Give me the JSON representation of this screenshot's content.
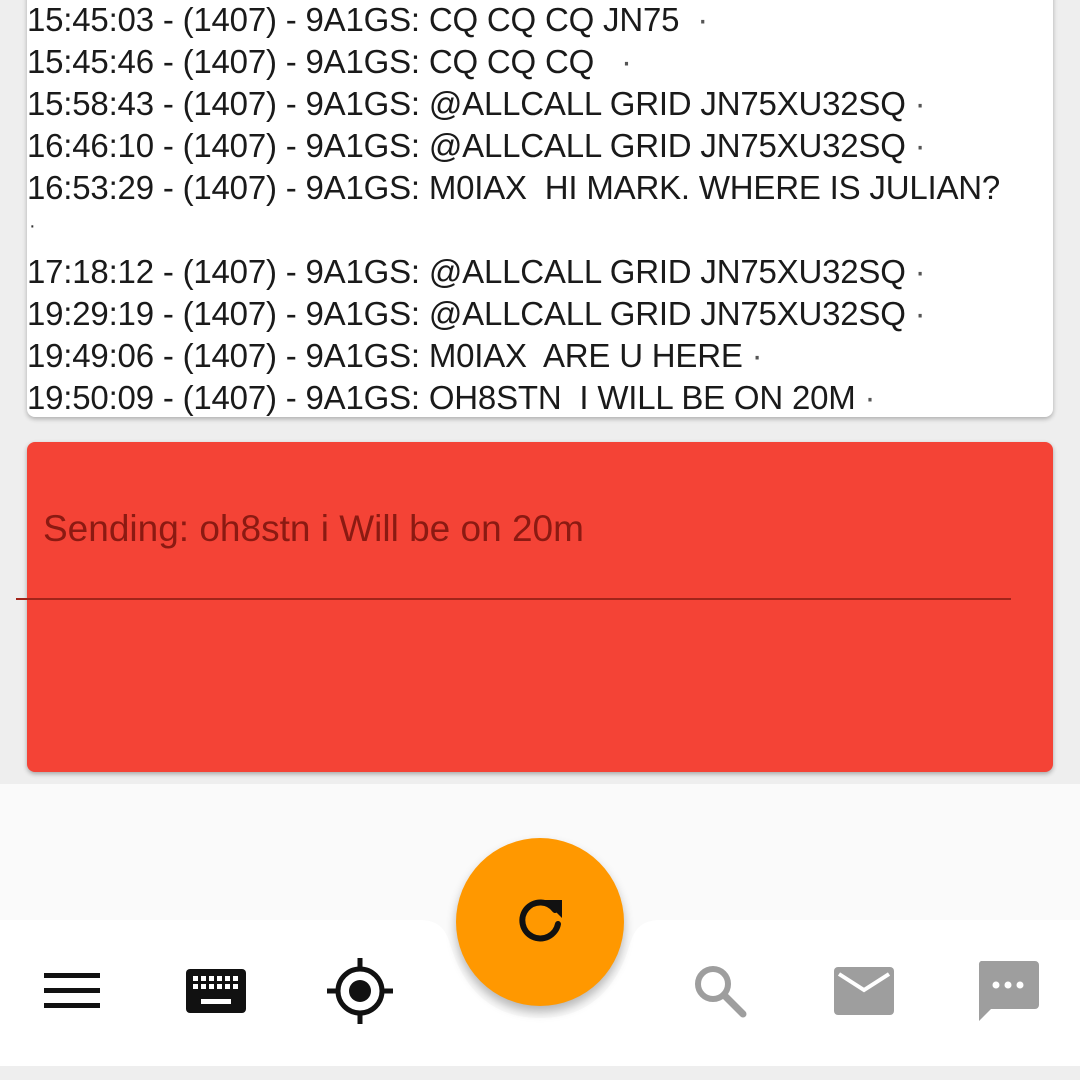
{
  "log": {
    "lines": [
      {
        "text": "15:45:03 - (1407) - 9A1GS: CQ CQ CQ JN75  ",
        "dot": "·"
      },
      {
        "text": "15:45:46 - (1407) - 9A1GS: CQ CQ CQ   ",
        "dot": "·"
      },
      {
        "text": "15:58:43 - (1407) - 9A1GS: @ALLCALL GRID JN75XU32SQ ",
        "dot": "·"
      },
      {
        "text": "16:46:10 - (1407) - 9A1GS: @ALLCALL GRID JN75XU32SQ ",
        "dot": "·"
      },
      {
        "text": "16:53:29 - (1407) - 9A1GS: M0IAX  HI MARK. WHERE IS JULIAN?",
        "dot": ""
      },
      {
        "text": "17:18:12 - (1407) - 9A1GS: @ALLCALL GRID JN75XU32SQ ",
        "dot": "·"
      },
      {
        "text": "19:29:19 - (1407) - 9A1GS: @ALLCALL GRID JN75XU32SQ ",
        "dot": "·"
      },
      {
        "text": "19:49:06 - (1407) - 9A1GS: M0IAX  ARE U HERE ",
        "dot": "·"
      },
      {
        "text": "19:50:09 - (1407) - 9A1GS: OH8STN  I WILL BE ON 20M ",
        "dot": "·"
      }
    ],
    "wrap_dot": "·"
  },
  "sending": {
    "text": "Sending: oh8stn i Will be on 20m",
    "color": "#f44336"
  },
  "fab": {
    "icon": "refresh-icon",
    "color": "#ff9800"
  },
  "nav": {
    "items": [
      {
        "icon": "menu-icon"
      },
      {
        "icon": "keyboard-icon"
      },
      {
        "icon": "gps-location-icon"
      },
      {
        "icon": "search-icon"
      },
      {
        "icon": "mail-icon"
      },
      {
        "icon": "chat-icon"
      }
    ]
  }
}
